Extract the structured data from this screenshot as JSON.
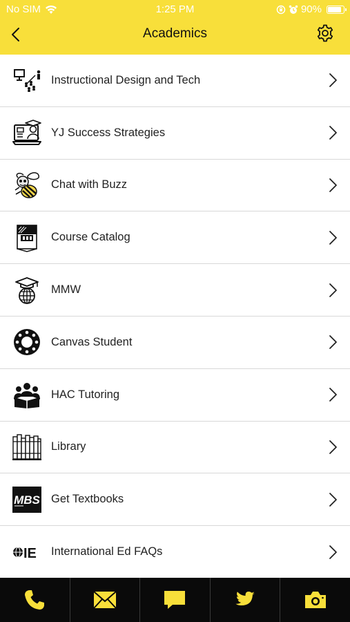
{
  "status_bar": {
    "carrier": "No SIM",
    "time": "1:25 PM",
    "battery_percent": "90%",
    "battery_level": 0.9
  },
  "nav": {
    "title": "Academics"
  },
  "items": [
    {
      "label": "Instructional Design and Tech",
      "icon": "presentation-icon"
    },
    {
      "label": "YJ Success Strategies",
      "icon": "graduate-computer-icon"
    },
    {
      "label": "Chat with Buzz",
      "icon": "bee-mascot-icon"
    },
    {
      "label": "Course Catalog",
      "icon": "catalog-book-icon"
    },
    {
      "label": "MMW",
      "icon": "graduation-globe-icon"
    },
    {
      "label": "Canvas Student",
      "icon": "canvas-logo-icon"
    },
    {
      "label": "HAC Tutoring",
      "icon": "group-tutoring-icon"
    },
    {
      "label": "Library",
      "icon": "bookshelf-icon"
    },
    {
      "label": "Get Textbooks",
      "icon": "mbs-logo-icon",
      "logo_text": "MBS"
    },
    {
      "label": "International Ed FAQs",
      "icon": "ie-globe-icon",
      "logo_text": "IE"
    }
  ],
  "tabs": [
    {
      "icon": "phone-icon"
    },
    {
      "icon": "mail-icon"
    },
    {
      "icon": "chat-icon"
    },
    {
      "icon": "twitter-icon"
    },
    {
      "icon": "camera-icon"
    }
  ],
  "colors": {
    "accent": "#f8df3a",
    "tab_bar": "#0a0a0a"
  }
}
